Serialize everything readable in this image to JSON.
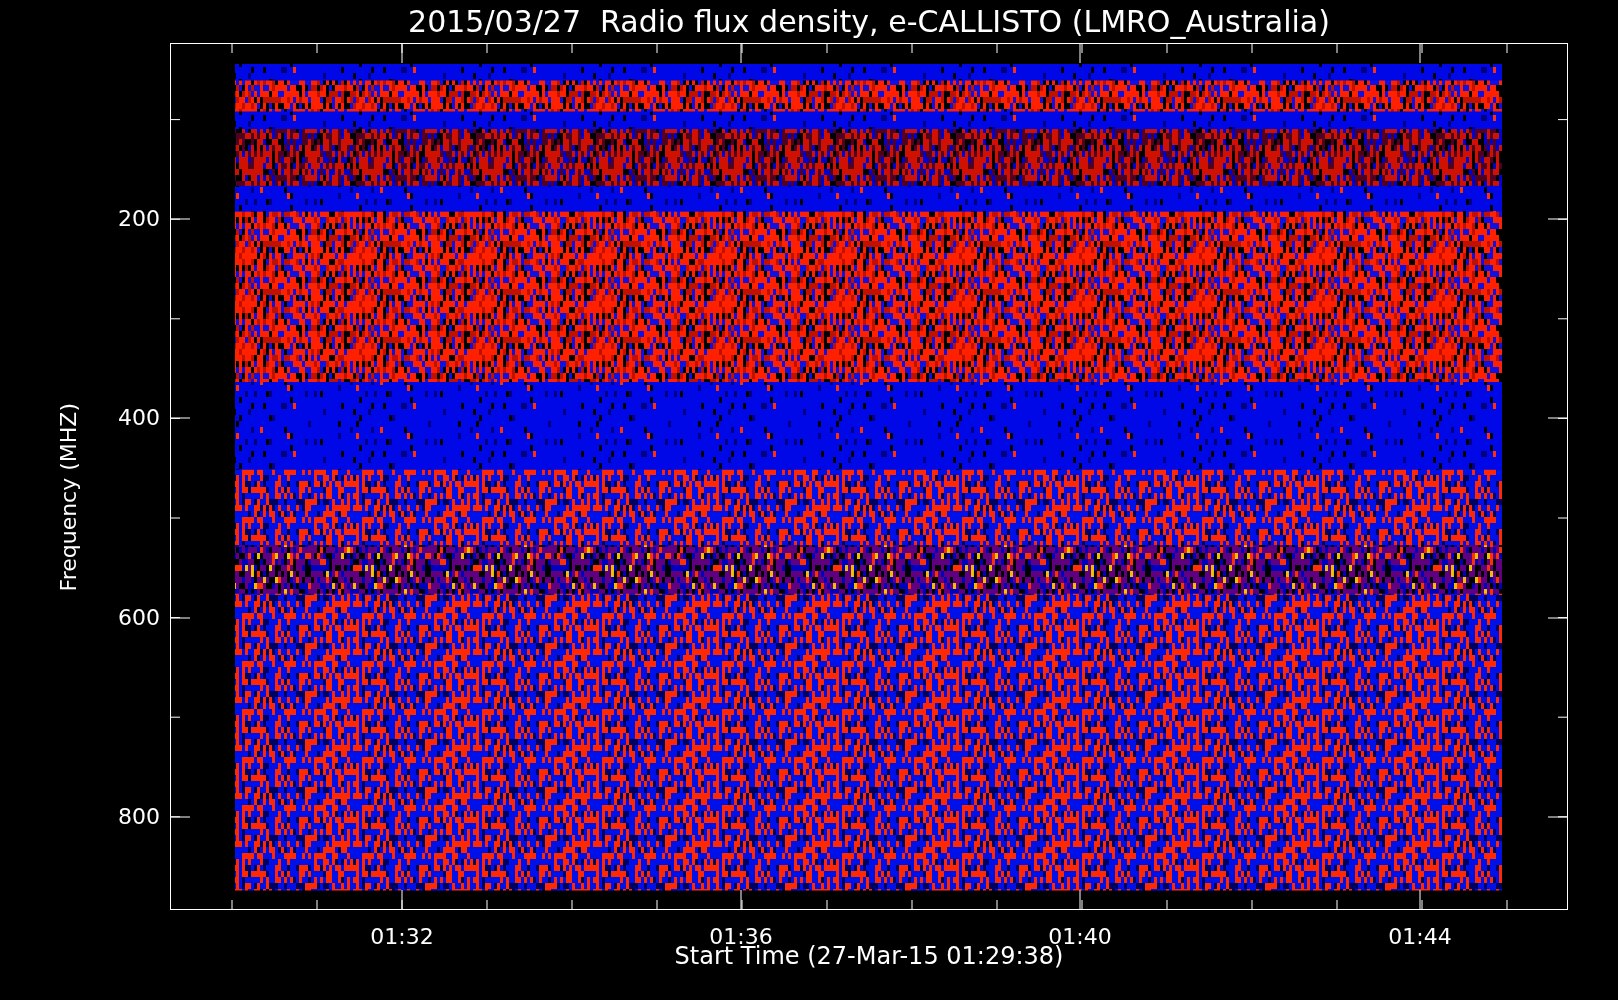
{
  "title": "2015/03/27  Radio flux density, e-CALLISTO (LMRO_Australia)",
  "y_axis": {
    "label": "Frequency (MHZ)",
    "tick_labels": [
      "200",
      "400",
      "600",
      "800"
    ]
  },
  "x_axis": {
    "label": "Start Time (27-Mar-15 01:29:38)",
    "tick_labels": [
      "01:32",
      "01:36",
      "01:40",
      "01:44"
    ]
  }
}
